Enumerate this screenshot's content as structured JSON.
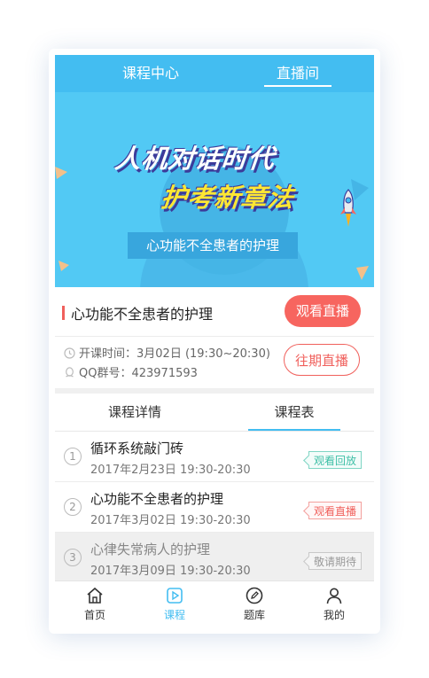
{
  "top_tabs": [
    {
      "label": "课程中心"
    },
    {
      "label": "直播间"
    }
  ],
  "banner": {
    "headline_1": "人机对话时代",
    "headline_2": "护考新章法",
    "subtitle": "心功能不全患者的护理"
  },
  "course": {
    "title": "心功能不全患者的护理",
    "watch_live_label": "观看直播",
    "past_live_label": "往期直播",
    "time_label": "开课时间：3月02日 (19:30~20:30)",
    "qq_label": "QQ群号：423971593"
  },
  "detail_tabs": [
    {
      "label": "课程详情"
    },
    {
      "label": "课程表"
    }
  ],
  "lessons": [
    {
      "num": "1",
      "title": "循环系统敲门砖",
      "date": "2017年2月23日   19:30-20:30",
      "tag": "观看回放"
    },
    {
      "num": "2",
      "title": "心功能不全患者的护理",
      "date": "2017年3月02日   19:30-20:30",
      "tag": "观看直播"
    },
    {
      "num": "3",
      "title": "心律失常病人的护理",
      "date": "2017年3月09日   19:30-20:30",
      "tag": "敬请期待"
    }
  ],
  "bottom_nav": [
    {
      "label": "首页",
      "icon": "home-icon"
    },
    {
      "label": "课程",
      "icon": "play-icon"
    },
    {
      "label": "题库",
      "icon": "pen-icon"
    },
    {
      "label": "我的",
      "icon": "user-icon"
    }
  ],
  "colors": {
    "accent": "#43bdf1",
    "live_red": "#f7655f",
    "replay_green": "#3ebfa6"
  }
}
